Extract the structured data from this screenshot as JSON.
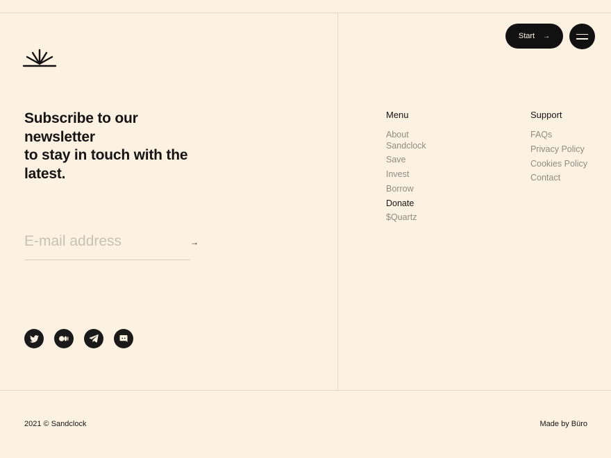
{
  "header": {
    "start_label": "Start",
    "start_arrow": "→"
  },
  "newsletter": {
    "headline_lines": [
      "Subscribe to our",
      "newsletter",
      "to stay in touch with the",
      "latest."
    ],
    "email_placeholder": "E-mail address",
    "email_value": "",
    "submit_arrow": "→"
  },
  "socials": [
    "twitter-icon",
    "medium-icon",
    "telegram-icon",
    "discord-icon"
  ],
  "menu": {
    "title": "Menu",
    "items": [
      {
        "label": "About Sandclock",
        "active": false
      },
      {
        "label": "Save",
        "active": false
      },
      {
        "label": "Invest",
        "active": false
      },
      {
        "label": "Borrow",
        "active": false
      },
      {
        "label": "Donate",
        "active": true
      },
      {
        "label": "$Quartz",
        "active": false
      }
    ]
  },
  "support": {
    "title": "Support",
    "items": [
      {
        "label": "FAQs"
      },
      {
        "label": "Privacy Policy"
      },
      {
        "label": "Cookies Policy"
      },
      {
        "label": "Contact"
      }
    ]
  },
  "footer": {
    "copyright": "2021 © Sandclock",
    "credit": "Made by Büro"
  },
  "colors": {
    "background": "#fdf2e2",
    "text": "#141414",
    "muted": "#8f8a83",
    "button": "#111111"
  }
}
